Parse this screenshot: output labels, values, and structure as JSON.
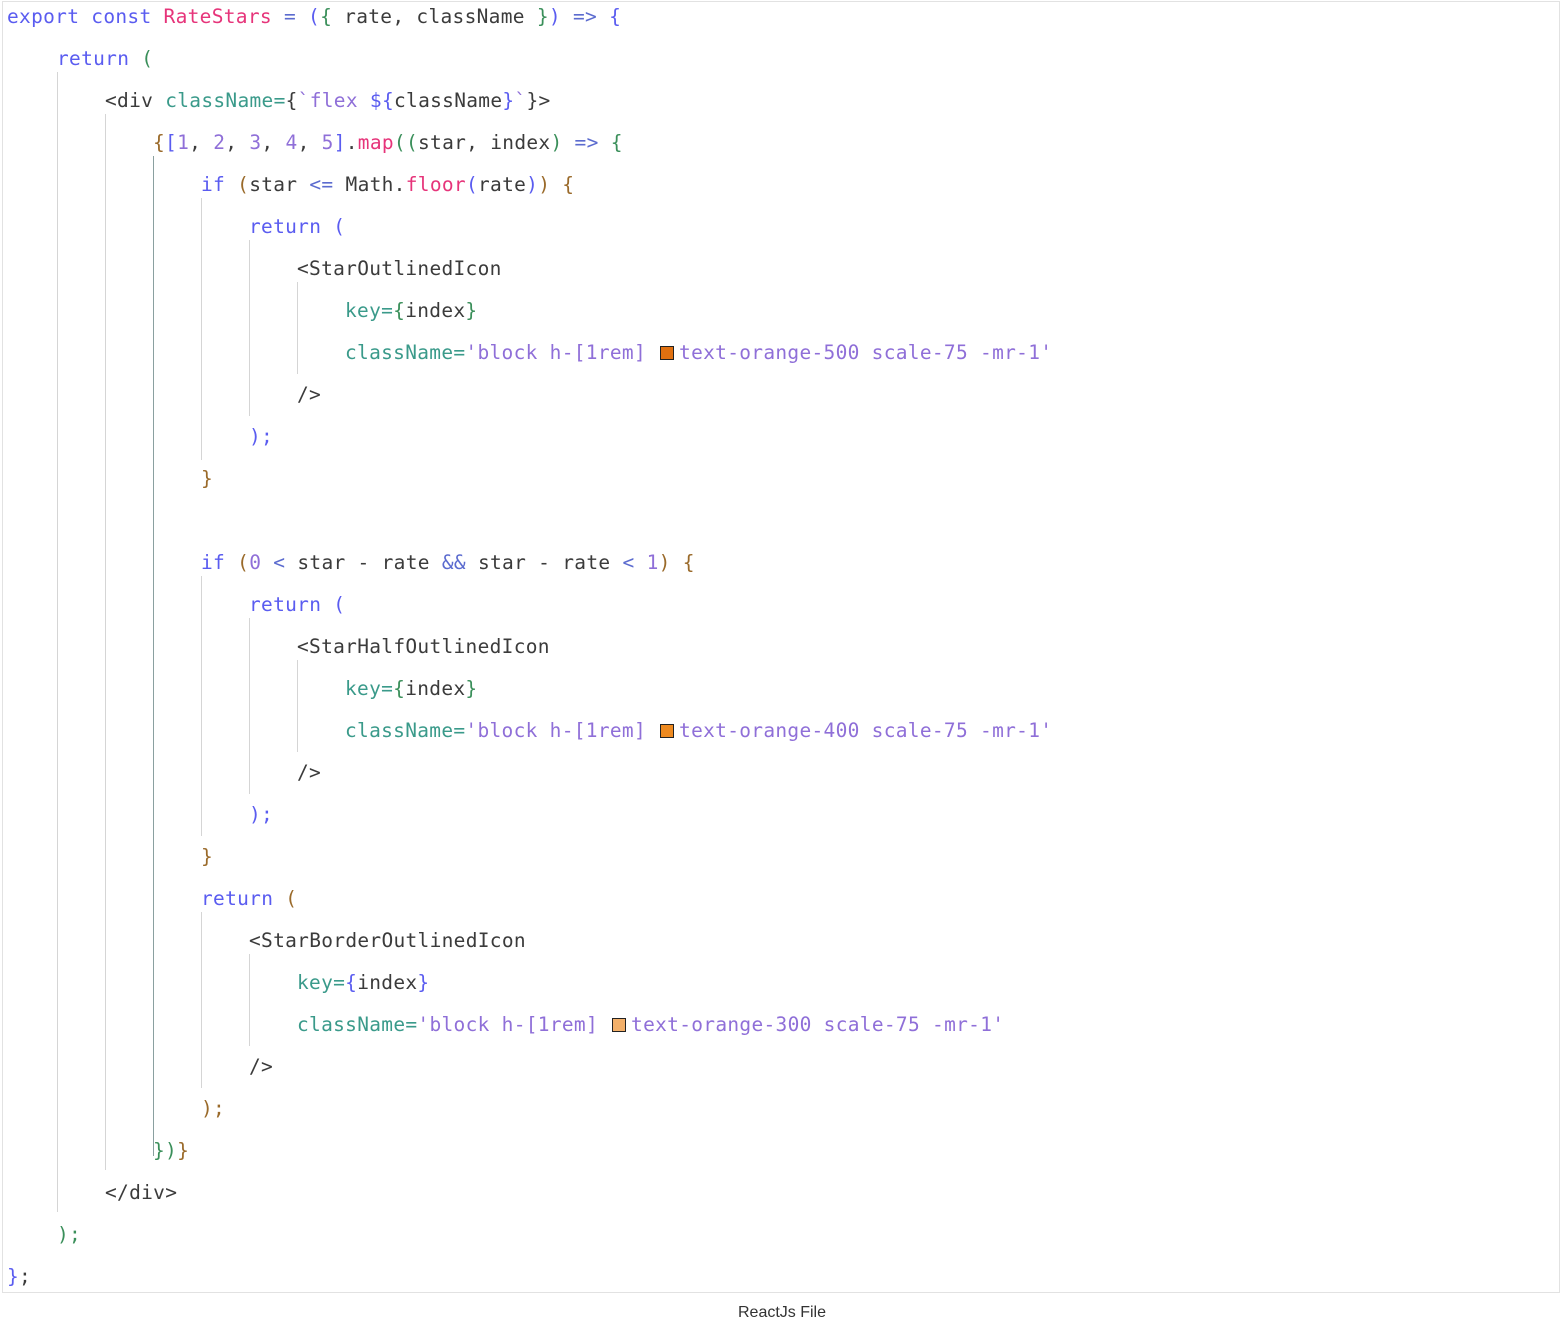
{
  "caption": "ReactJs File",
  "swatches": {
    "orange_500": "#e07010",
    "orange_400": "#ee8a20",
    "orange_300": "#f3b06a"
  },
  "code": {
    "l1": {
      "export": "export",
      "const": "const",
      "name": "RateStars",
      "eq": " = ",
      "open": "(",
      "brace": "{",
      "params": " rate, className ",
      "close_brace": "}",
      "close": ")",
      "arrow": " => ",
      "body": "{"
    },
    "l2": {
      "ret": "return",
      "paren": " ("
    },
    "l3": {
      "tag": "<div ",
      "attr": "className=",
      "b_open": "{",
      "tick": "`",
      "flex": "flex ",
      "interp_open": "${",
      "var": "className",
      "interp_close": "}",
      "tick2": "`",
      "b_close": "}",
      "end": ">"
    },
    "l4": {
      "b_open": "{",
      "arr_open": "[",
      "n1": "1",
      "c1": ", ",
      "n2": "2",
      "c2": ", ",
      "n3": "3",
      "c3": ", ",
      "n4": "4",
      "c4": ", ",
      "n5": "5",
      "arr_close": "]",
      "dot": ".",
      "map": "map",
      "p_open": "((",
      "args": "star, index",
      "p_close": ")",
      "arrow": " => ",
      "body": "{"
    },
    "l5": {
      "if": "if",
      "p_open": " (",
      "star": "star ",
      "op": "<=",
      "math": " Math.",
      "floor": "floor",
      "p2": "(",
      "rate": "rate",
      "p3": ")",
      "p_close": ")",
      "body": " {"
    },
    "l6": {
      "ret": "return",
      "paren": " ("
    },
    "l7": {
      "tag": "<StarOutlinedIcon"
    },
    "l8": {
      "attr": "key=",
      "b_open": "{",
      "val": "index",
      "b_close": "}"
    },
    "l9": {
      "attr": "className=",
      "str1": "'block h-[1rem] ",
      "str2": "text-orange-500 scale-75 -mr-1'"
    },
    "l10": {
      "tag": "/>"
    },
    "l11": {
      "text": ");"
    },
    "l12": {
      "text": "}"
    },
    "l13": {
      "if": "if",
      "p_open": " (",
      "zero": "0",
      "lt": " < ",
      "a": "star - rate ",
      "and": "&&",
      "b": " star - rate ",
      "lt2": "<",
      "sp": " ",
      "one": "1",
      "p_close": ")",
      "body": " {"
    },
    "l14": {
      "ret": "return",
      "paren": " ("
    },
    "l15": {
      "tag": "<StarHalfOutlinedIcon"
    },
    "l16": {
      "attr": "key=",
      "b_open": "{",
      "val": "index",
      "b_close": "}"
    },
    "l17": {
      "attr": "className=",
      "str1": "'block h-[1rem] ",
      "str2": "text-orange-400 scale-75 -mr-1'"
    },
    "l18": {
      "tag": "/>"
    },
    "l19": {
      "text": ");"
    },
    "l20": {
      "text": "}"
    },
    "l21": {
      "ret": "return",
      "paren": " ("
    },
    "l22": {
      "tag": "<StarBorderOutlinedIcon"
    },
    "l23": {
      "attr": "key=",
      "b_open": "{",
      "val": "index",
      "b_close": "}"
    },
    "l24": {
      "attr": "className=",
      "str1": "'block h-[1rem] ",
      "str2": "text-orange-300 scale-75 -mr-1'"
    },
    "l25": {
      "tag": "/>"
    },
    "l26": {
      "text": ");"
    },
    "l27": {
      "b1": "}",
      "b2": ")",
      "b3": "}"
    },
    "l28": {
      "tag": "</div>"
    },
    "l29": {
      "text": ");"
    },
    "l30": {
      "brace": "}",
      "semi": ";"
    }
  }
}
